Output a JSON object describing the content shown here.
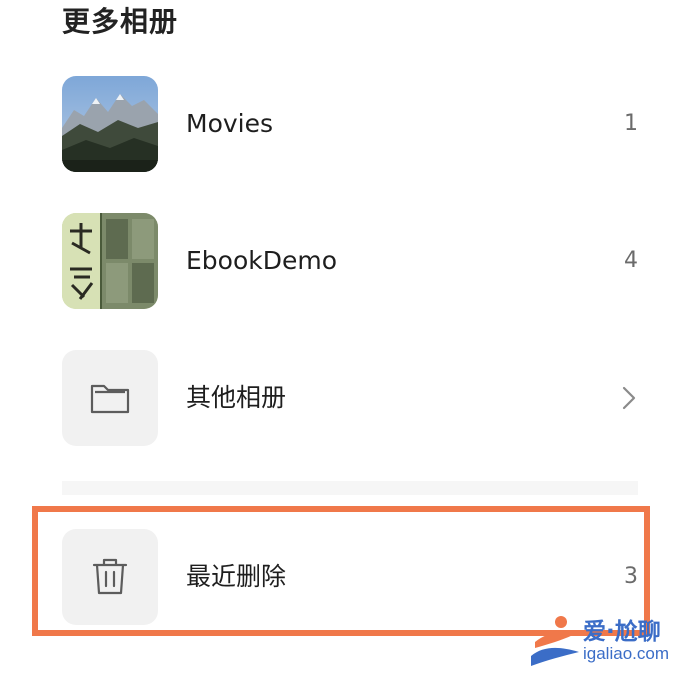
{
  "section": {
    "title": "更多相册"
  },
  "albums": [
    {
      "name": "Movies",
      "count": "1",
      "thumbnail_icon": "mountain-landscape-thumbnail"
    },
    {
      "name": "EbookDemo",
      "count": "4",
      "thumbnail_icon": "ebook-cover-thumbnail"
    },
    {
      "name": "其他相册",
      "count": "",
      "thumbnail_icon": "folder-icon",
      "trailing_icon": "chevron-right-icon"
    }
  ],
  "recently_deleted": {
    "name": "最近删除",
    "count": "3",
    "icon": "trash-icon",
    "highlight_color": "#f0784a"
  },
  "watermark": {
    "main": "爱·尬聊",
    "sub": "igaliao.com"
  }
}
